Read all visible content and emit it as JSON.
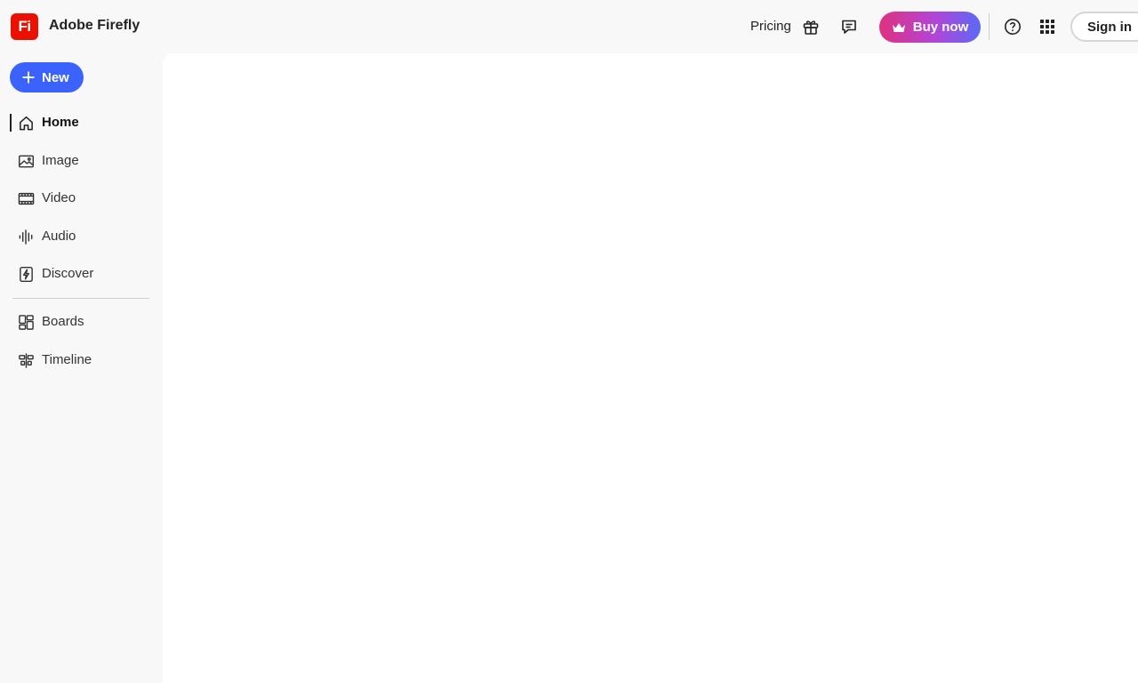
{
  "app": {
    "logo_text": "Fi",
    "title": "Adobe Firefly",
    "brand_color": "#eb1000"
  },
  "header": {
    "pricing_label": "Pricing",
    "gift_icon": "gift-icon",
    "feedback_icon": "chat-icon",
    "buy_now_label": "Buy now",
    "buy_now_icon": "crown-icon",
    "help_icon": "help-icon",
    "apps_icon": "apps-grid-icon",
    "sign_in_label": "Sign in"
  },
  "sidebar": {
    "new_label": "New",
    "new_button_color": "#3b63fb",
    "items": [
      {
        "label": "Home",
        "icon": "home-icon",
        "active": true
      },
      {
        "label": "Image",
        "icon": "image-icon",
        "active": false
      },
      {
        "label": "Video",
        "icon": "video-icon",
        "active": false
      },
      {
        "label": "Audio",
        "icon": "audio-icon",
        "active": false
      },
      {
        "label": "Discover",
        "icon": "discover-icon",
        "active": false
      },
      {
        "label": "Boards",
        "icon": "boards-icon",
        "active": false
      },
      {
        "label": "Timeline",
        "icon": "timeline-icon",
        "active": false
      }
    ]
  }
}
